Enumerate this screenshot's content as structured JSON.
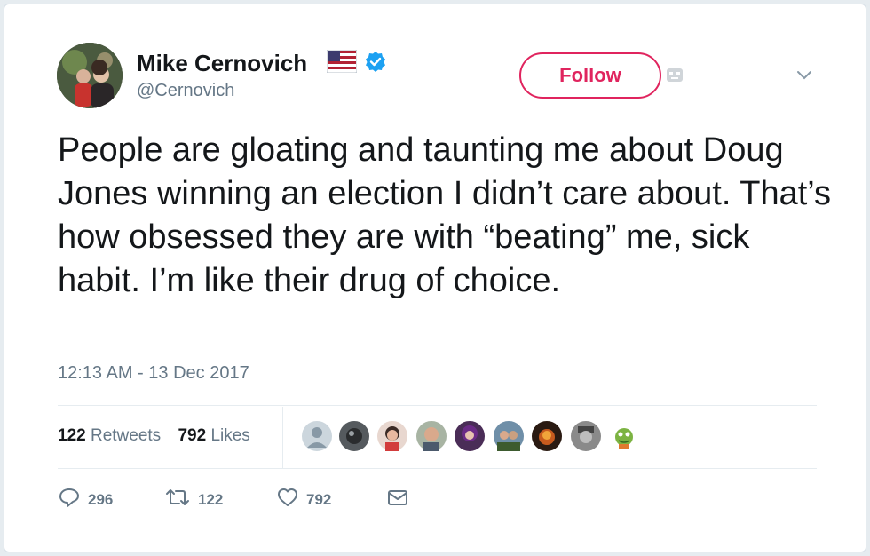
{
  "author": {
    "display_name": "Mike Cernovich",
    "handle": "@Cernovich"
  },
  "header": {
    "follow_label": "Follow"
  },
  "tweet": {
    "text": "People are gloating and taunting me about Doug Jones winning an election I didn’t care about. That’s how obsessed they are with “beating” me, sick habit. I’m like their drug of choice.",
    "timestamp": "12:13 AM - 13 Dec 2017"
  },
  "stats": {
    "retweets_count": "122",
    "retweets_label": "Retweets",
    "likes_count": "792",
    "likes_label": "Likes"
  },
  "liker_avatars": [
    {
      "name": "default-avatar"
    },
    {
      "name": "avatar-dark"
    },
    {
      "name": "avatar-woman"
    },
    {
      "name": "avatar-man-smiling"
    },
    {
      "name": "avatar-purple"
    },
    {
      "name": "avatar-man-outdoor"
    },
    {
      "name": "avatar-fire"
    },
    {
      "name": "avatar-grayscale"
    },
    {
      "name": "avatar-frog"
    }
  ],
  "actions": {
    "reply_count": "296",
    "retweet_count": "122",
    "like_count": "792"
  },
  "colors": {
    "follow_accent": "#e0245e",
    "verified_blue": "#1da1f2",
    "secondary_text": "#657786"
  },
  "icons": {
    "verified": "verified-badge-icon",
    "flag": "us-flag-icon",
    "reply": "reply-bubble-icon",
    "retweet": "retweet-arrows-icon",
    "like": "heart-icon",
    "dm": "envelope-icon",
    "menu": "chevron-down-icon"
  }
}
